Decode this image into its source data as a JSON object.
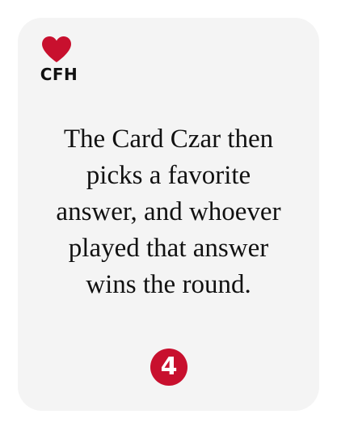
{
  "logo": {
    "icon": "heart-icon",
    "text": "CFH",
    "color": "#c8102e"
  },
  "card": {
    "background": "#f4f4f4",
    "lines": [
      "The Card Czar then",
      "picks a favorite",
      "answer, and whoever",
      "played that answer",
      "wins the round."
    ]
  },
  "step": {
    "number": "4",
    "color": "#c8102e"
  }
}
